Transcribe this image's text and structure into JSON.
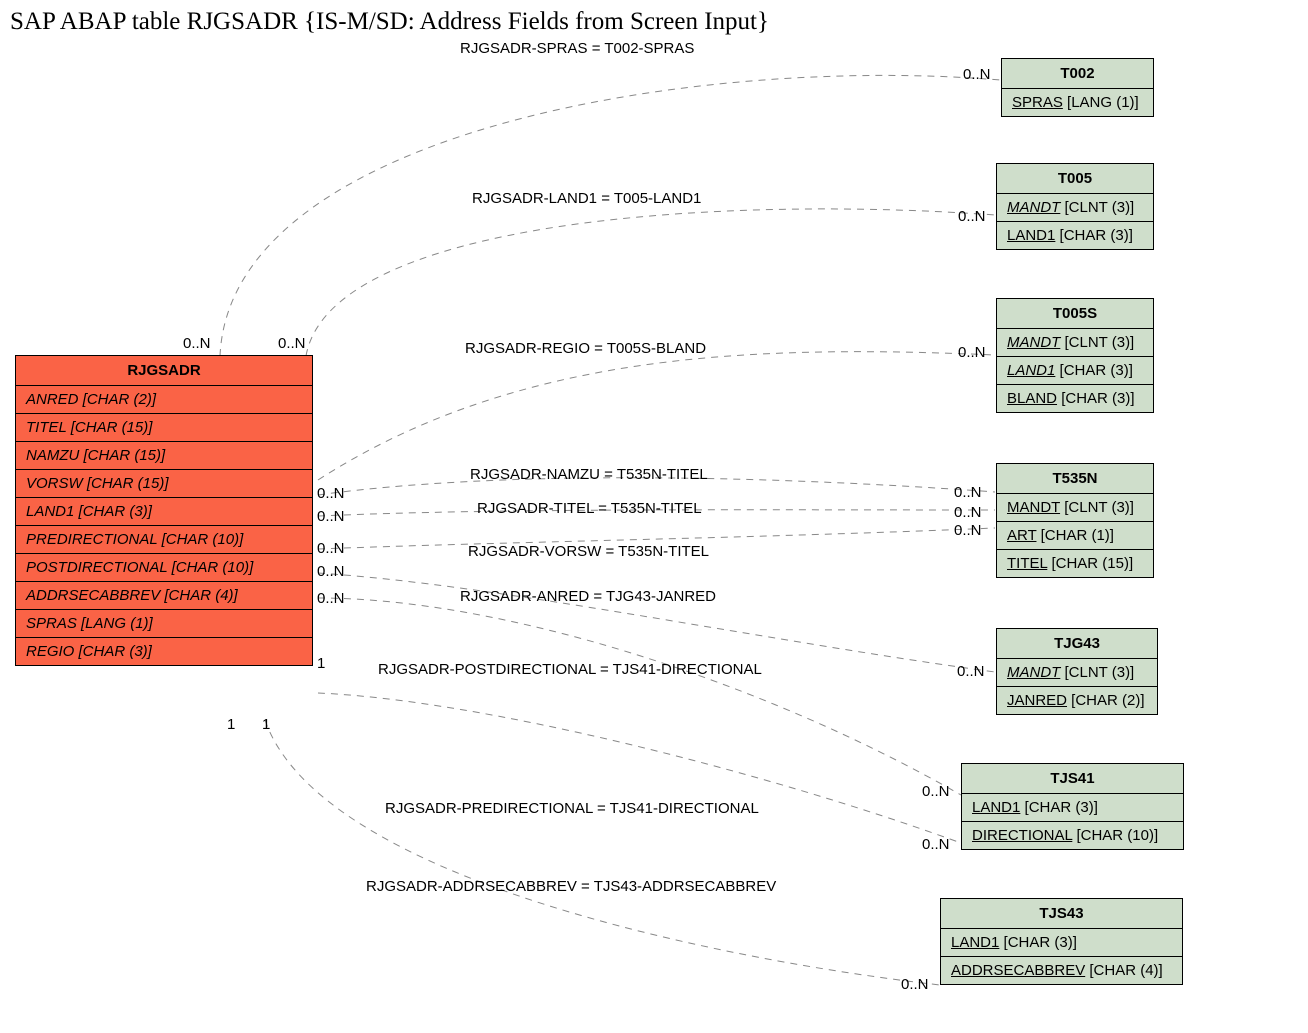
{
  "title": "SAP ABAP table RJGSADR {IS-M/SD: Address Fields from Screen Input}",
  "main_entity": {
    "name": "RJGSADR",
    "fields": [
      "ANRED [CHAR (2)]",
      "TITEL [CHAR (15)]",
      "NAMZU [CHAR (15)]",
      "VORSW [CHAR (15)]",
      "LAND1 [CHAR (3)]",
      "PREDIRECTIONAL [CHAR (10)]",
      "POSTDIRECTIONAL [CHAR (10)]",
      "ADDRSECABBREV [CHAR (4)]",
      "SPRAS [LANG (1)]",
      "REGIO [CHAR (3)]"
    ]
  },
  "ref_entities": {
    "t002": {
      "name": "T002",
      "rows": [
        {
          "k": "SPRAS",
          "t": " [LANG (1)]",
          "cls": "fk"
        }
      ]
    },
    "t005": {
      "name": "T005",
      "rows": [
        {
          "k": "MANDT",
          "t": " [CLNT (3)]",
          "cls": "fk-italic"
        },
        {
          "k": "LAND1",
          "t": " [CHAR (3)]",
          "cls": "fk"
        }
      ]
    },
    "t005s": {
      "name": "T005S",
      "rows": [
        {
          "k": "MANDT",
          "t": " [CLNT (3)]",
          "cls": "fk-italic"
        },
        {
          "k": "LAND1",
          "t": " [CHAR (3)]",
          "cls": "fk-italic"
        },
        {
          "k": "BLAND",
          "t": " [CHAR (3)]",
          "cls": "fk"
        }
      ]
    },
    "t535n": {
      "name": "T535N",
      "rows": [
        {
          "k": "MANDT",
          "t": " [CLNT (3)]",
          "cls": "fk"
        },
        {
          "k": "ART",
          "t": " [CHAR (1)]",
          "cls": "fk"
        },
        {
          "k": "TITEL",
          "t": " [CHAR (15)]",
          "cls": "fk"
        }
      ]
    },
    "tjg43": {
      "name": "TJG43",
      "rows": [
        {
          "k": "MANDT",
          "t": " [CLNT (3)]",
          "cls": "fk-italic"
        },
        {
          "k": "JANRED",
          "t": " [CHAR (2)]",
          "cls": "fk"
        }
      ]
    },
    "tjs41": {
      "name": "TJS41",
      "rows": [
        {
          "k": "LAND1",
          "t": " [CHAR (3)]",
          "cls": "fk"
        },
        {
          "k": "DIRECTIONAL",
          "t": " [CHAR (10)]",
          "cls": "fk"
        }
      ]
    },
    "tjs43": {
      "name": "TJS43",
      "rows": [
        {
          "k": "LAND1",
          "t": " [CHAR (3)]",
          "cls": "fk"
        },
        {
          "k": "ADDRSECABBREV",
          "t": " [CHAR (4)]",
          "cls": "fk"
        }
      ]
    }
  },
  "relations": {
    "r1": "RJGSADR-SPRAS = T002-SPRAS",
    "r2": "RJGSADR-LAND1 = T005-LAND1",
    "r3": "RJGSADR-REGIO = T005S-BLAND",
    "r4": "RJGSADR-NAMZU = T535N-TITEL",
    "r5": "RJGSADR-TITEL = T535N-TITEL",
    "r6": "RJGSADR-VORSW = T535N-TITEL",
    "r7": "RJGSADR-ANRED = TJG43-JANRED",
    "r8": "RJGSADR-POSTDIRECTIONAL = TJS41-DIRECTIONAL",
    "r9": "RJGSADR-PREDIRECTIONAL = TJS41-DIRECTIONAL",
    "r10": "RJGSADR-ADDRSECABBREV = TJS43-ADDRSECABBREV"
  },
  "cards": {
    "c_main_top_l": "0..N",
    "c_main_top_r": "0..N",
    "c_main_r1": "0..N",
    "c_main_r2": "0..N",
    "c_main_r3": "0..N",
    "c_main_r4": "0..N",
    "c_main_r5": "0..N",
    "c_main_r6": "1",
    "c_main_bot_l": "1",
    "c_main_bot_r": "1",
    "c_t002": "0..N",
    "c_t005": "0..N",
    "c_t005s": "0..N",
    "c_t535n_1": "0..N",
    "c_t535n_2": "0..N",
    "c_t535n_3": "0..N",
    "c_tjg43": "0..N",
    "c_tjs41_1": "0..N",
    "c_tjs41_2": "0..N",
    "c_tjs43": "0..N"
  }
}
